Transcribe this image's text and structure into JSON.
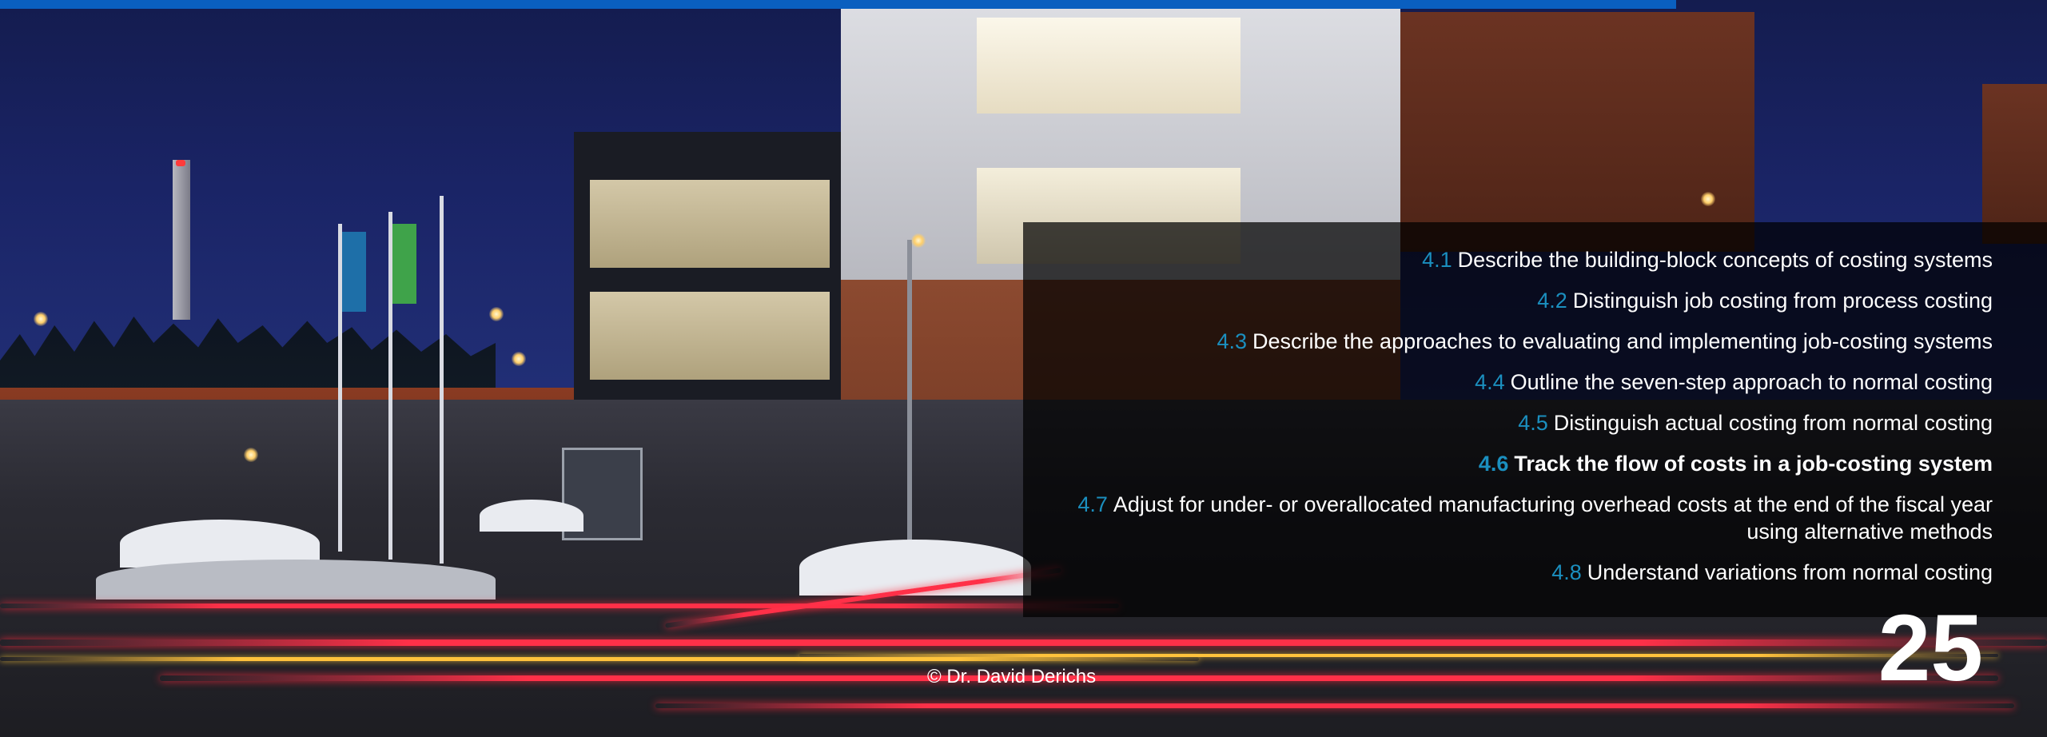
{
  "slide": {
    "accent_color": "#0a5fbf",
    "number_color": "#1b8fbf",
    "copyright": "© Dr. David Derichs",
    "page_number": "25",
    "background_image": "campus-building-night-photo"
  },
  "objectives": [
    {
      "num": "4.1",
      "text": "Describe the building-block concepts of costing systems",
      "active": false
    },
    {
      "num": "4.2",
      "text": "Distinguish job costing from process costing",
      "active": false
    },
    {
      "num": "4.3",
      "text": "Describe the approaches to evaluating and implementing job-costing systems",
      "active": false
    },
    {
      "num": "4.4",
      "text": "Outline the seven-step approach to normal costing",
      "active": false
    },
    {
      "num": "4.5",
      "text": "Distinguish actual costing from normal costing",
      "active": false
    },
    {
      "num": "4.6",
      "text": "Track the flow of costs in a job-costing system",
      "active": true
    },
    {
      "num": "4.7",
      "text": "Adjust for under- or overallocated manufacturing overhead costs at the end of the fiscal year using alternative methods",
      "active": false
    },
    {
      "num": "4.8",
      "text": "Understand variations from normal costing",
      "active": false
    }
  ]
}
